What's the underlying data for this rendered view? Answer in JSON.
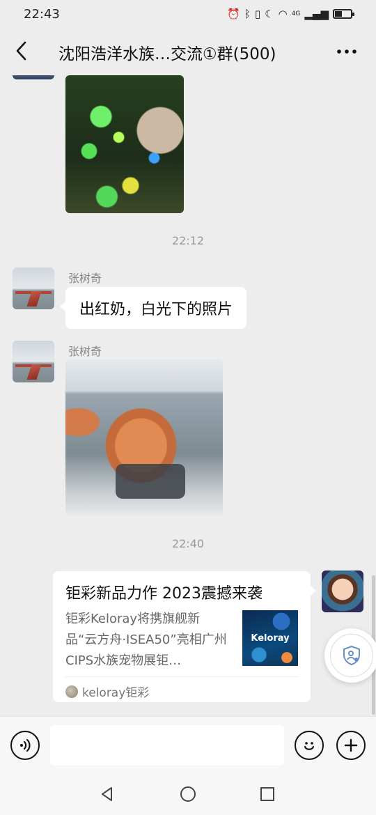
{
  "status_bar": {
    "time": "22:43",
    "signal_label": "4G"
  },
  "header": {
    "title": "沈阳浩洋水族…交流①群(500)"
  },
  "messages": {
    "timestamp_1": "22:12",
    "msg1_sender": "张树奇",
    "msg1_text": "出红奶，白光下的照片",
    "msg2_sender": "张树奇",
    "timestamp_2": "22:40"
  },
  "link_card": {
    "title": "钜彩新品力作 2023震撼来袭",
    "description": "钜彩Keloray将携旗舰新品“云方舟·ISEA50”亮相广州CIPS水族宠物展钜…",
    "thumbnail_text": "Keloray",
    "source": "keloray钜彩"
  },
  "input": {
    "value": ""
  },
  "icons": {
    "back": "back-arrow-icon",
    "more": "more-dots-icon",
    "voice": "voice-icon",
    "emoji": "emoji-icon",
    "add": "add-icon",
    "accessibility": "shield-person-icon",
    "nav_back": "triangle-back-icon",
    "nav_home": "circle-home-icon",
    "nav_recent": "square-recent-icon"
  },
  "colors": {
    "background": "#ededed",
    "bubble": "#ffffff",
    "timestamp": "#999999"
  }
}
